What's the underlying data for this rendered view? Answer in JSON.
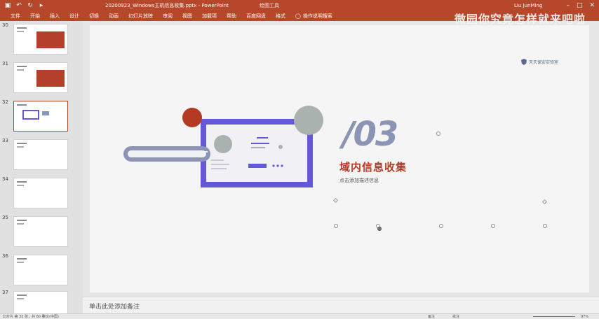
{
  "titlebar": {
    "document_title": "20200923_Windows主机信息收集.pptx - PowerPoint",
    "context_tab": "绘图工具",
    "user": "Liu JunMing",
    "save_icon": "save-icon",
    "undo_icon": "undo-icon",
    "redo_icon": "redo-icon"
  },
  "ribbon": {
    "tabs": [
      "文件",
      "开始",
      "插入",
      "设计",
      "切换",
      "动画",
      "幻灯片放映",
      "审阅",
      "视图",
      "加载项",
      "帮助",
      "百度网盘",
      "格式"
    ],
    "search_label": "操作说明搜索"
  },
  "watermark": "微园你究竟怎样就来吧啦",
  "thumbnails": [
    {
      "num": "30",
      "kind": "red"
    },
    {
      "num": "31",
      "kind": "red"
    },
    {
      "num": "32",
      "kind": "diagram",
      "active": true
    },
    {
      "num": "33",
      "kind": "text"
    },
    {
      "num": "34",
      "kind": "text"
    },
    {
      "num": "35",
      "kind": "text"
    },
    {
      "num": "36",
      "kind": "text"
    },
    {
      "num": "37",
      "kind": "text"
    }
  ],
  "slide": {
    "logo_text": "天天保安实验室",
    "section_number": "/03",
    "section_title": "域内信息收集",
    "section_subtitle": "点击添加描述信息"
  },
  "notes": {
    "placeholder": "单击此处添加备注"
  },
  "statusbar": {
    "slide_info": "幻灯片 第 32 张，共 60 张",
    "language": "中文(中国)",
    "notes_button": "备注",
    "comments_button": "批注",
    "zoom": "97%"
  },
  "colors": {
    "accent": "#b7472a",
    "slide_title": "#b43a24",
    "section_number": "#8b94b4",
    "illustration_purple": "#6558d8"
  }
}
